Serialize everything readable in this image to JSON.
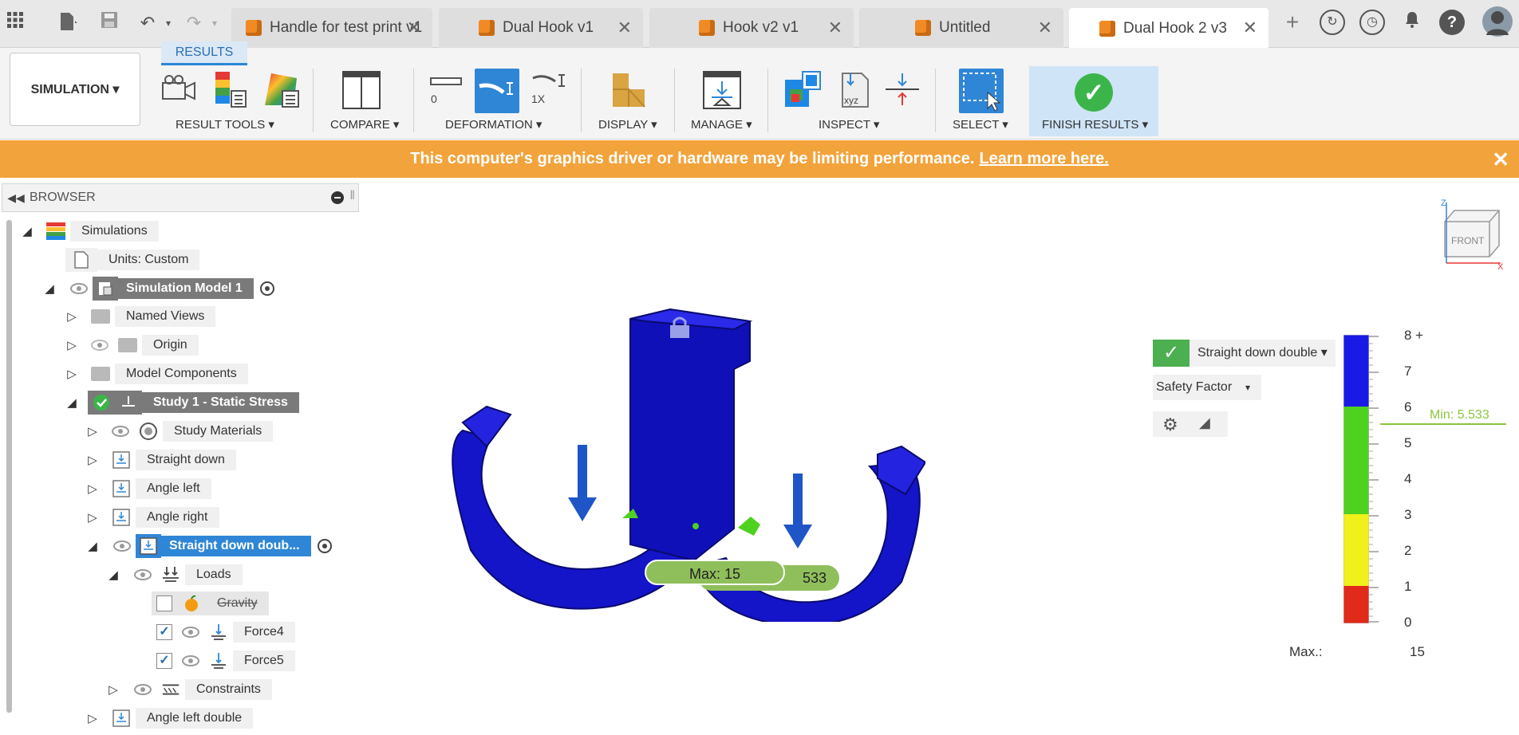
{
  "tabs": [
    {
      "label": "Handle for test print v1",
      "active": false
    },
    {
      "label": "Dual Hook v1",
      "active": false
    },
    {
      "label": "Hook v2 v1",
      "active": false
    },
    {
      "label": "Untitled",
      "active": false
    },
    {
      "label": "Dual Hook 2 v3",
      "active": true
    }
  ],
  "ribbon": {
    "results_tab": "RESULTS",
    "workspace": "SIMULATION ▾",
    "groups": {
      "result_tools": "RESULT TOOLS ▾",
      "compare": "COMPARE ▾",
      "deformation": "DEFORMATION ▾",
      "display": "DISPLAY ▾",
      "manage": "MANAGE ▾",
      "inspect": "INSPECT ▾",
      "select": "SELECT ▾",
      "finish": "FINISH RESULTS ▾"
    },
    "deformation_scale_zero": "0",
    "deformation_scale_1x": "1X",
    "accent": "#2f86d6"
  },
  "banner": {
    "text": "This computer's graphics driver or hardware may be limiting performance.",
    "link": "Learn more here.",
    "color": "#f3a33b"
  },
  "browser": {
    "title": "BROWSER",
    "items": {
      "simulations": "Simulations",
      "units": "Units: Custom",
      "sim_model": "Simulation Model 1",
      "named_views": "Named Views",
      "origin": "Origin",
      "model_components": "Model Components",
      "study": "Study 1 - Static Stress",
      "study_materials": "Study Materials",
      "straight_down": "Straight down",
      "angle_left": "Angle left",
      "angle_right": "Angle right",
      "straight_down_double": "Straight down doub...",
      "loads": "Loads",
      "gravity": "Gravity",
      "force4": "Force4",
      "force5": "Force5",
      "constraints": "Constraints",
      "angle_left_double": "Angle left double"
    }
  },
  "viewport": {
    "viewcube_face": "FRONT",
    "result_case": "Straight down double ▾",
    "result_type": "Safety Factor",
    "legend_ticks": [
      "8 +",
      "7",
      "6",
      "5",
      "4",
      "3",
      "2",
      "1",
      "0"
    ],
    "min_label": "Min: 5.533",
    "max_label": "Max.:",
    "max_value": "15",
    "probe_max": "Max: 15",
    "probe_min": "533",
    "legend_colors": {
      "blue": "#1a1ae6",
      "green": "#4fd11f",
      "yellow": "#f0f01a",
      "red": "#e02a1a"
    },
    "model_color": "#1414c8",
    "arrow_color": "#1e56c8"
  }
}
